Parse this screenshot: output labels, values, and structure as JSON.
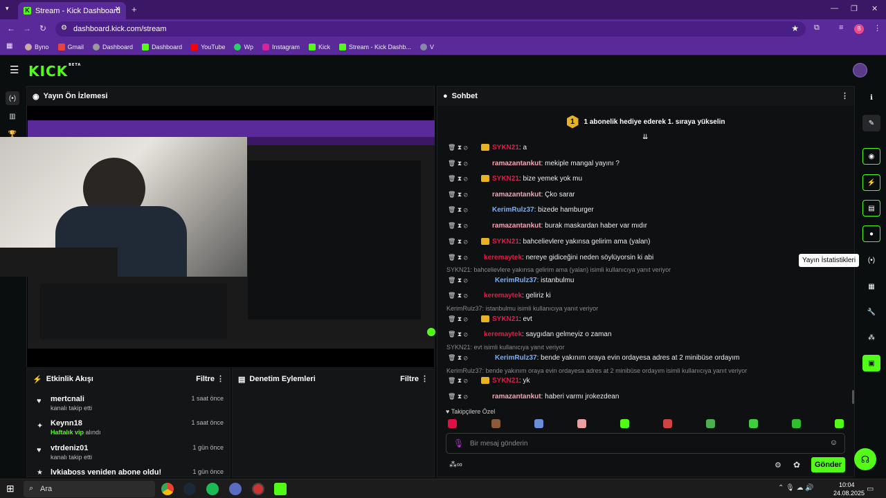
{
  "browser": {
    "tab_title": "Stream - Kick Dashboard",
    "url": "dashboard.kick.com/stream",
    "profile_initial": "B",
    "bookmarks": [
      "Byno",
      "Gmail",
      "Dashboard",
      "Dashboard",
      "YouTube",
      "Wp",
      "Instagram",
      "Kick",
      "Stream - Kick Dashb...",
      "V"
    ]
  },
  "kick": {
    "logo": "KICK",
    "logo_badge": "BETA"
  },
  "preview": {
    "title": "Yayın Ön İzlemesi"
  },
  "activity": {
    "title": "Etkinlik Akışı",
    "filter": "Filtre",
    "items": [
      {
        "name": "mertcnali",
        "sub": "kanalı takip etti",
        "time": "1 saat önce"
      },
      {
        "name": "Keynn18",
        "sub_highlight": "Haftalık vip",
        "sub": "alındı",
        "time": "1 saat önce"
      },
      {
        "name": "vtrdeniz01",
        "sub": "kanalı takip etti",
        "time": "1 gün önce"
      },
      {
        "name": "lvkiaboss veniden abone oldu!",
        "sub": "",
        "time": "1 gün önce"
      }
    ]
  },
  "moderation": {
    "title": "Denetim Eylemleri",
    "filter": "Filtre"
  },
  "chat": {
    "title": "Sohbet",
    "gift_count": "1",
    "gift_banner": "1 abonelik hediye ederek 1. sıraya yükselin",
    "messages": [
      {
        "user": "SYKN21",
        "color": "red",
        "badges": true,
        "text": ": a"
      },
      {
        "user": "ramazantankut",
        "color": "pink",
        "badges": false,
        "text": ": mekiple mangal yayını ?"
      },
      {
        "user": "SYKN21",
        "color": "red",
        "badges": true,
        "text": ": bize yemek yok mu"
      },
      {
        "user": "ramazantankut",
        "color": "pink",
        "badges": false,
        "text": ": Çko sarar"
      },
      {
        "user": "KerimRulz37",
        "color": "blue",
        "badges": false,
        "text": ": bizede hamburger"
      },
      {
        "user": "ramazantankut",
        "color": "pink",
        "badges": false,
        "text": ": burak maskardan haber var mıdır"
      },
      {
        "user": "SYKN21",
        "color": "red",
        "badges": true,
        "text": ": bahcelievlere yakınsa gelirim ama (yalan)"
      },
      {
        "user": "keremaytek",
        "color": "red",
        "badges": false,
        "text": ": nereye gidiceğini neden söylüyorsin ki abi"
      },
      {
        "reply": "SYKN21: bahcelievlere yakınsa gelirim ama (yalan) isimli kullanıcıya yanıt veriyor"
      },
      {
        "user": "KerimRulz37",
        "color": "blue",
        "badges": false,
        "text": ": istanbulmu"
      },
      {
        "user": "keremaytek",
        "color": "red",
        "badges": false,
        "text": ": geliriz ki"
      },
      {
        "reply": "KerimRulz37: istanbulmu isimli kullanıcıya yanıt veriyor"
      },
      {
        "user": "SYKN21",
        "color": "red",
        "badges": true,
        "text": ": evt"
      },
      {
        "user": "keremaytek",
        "color": "red",
        "badges": false,
        "text": ": saygıdan gelmeyiz o zaman"
      },
      {
        "reply": "SYKN21: evt isimli kullanıcıya yanıt veriyor"
      },
      {
        "user": "KerimRulz37",
        "color": "blue",
        "badges": false,
        "text": ": bende yakınım oraya evin ordayesa adres at 2 minibüse ordayım"
      },
      {
        "reply": "KerimRulz37: bende yakınım oraya evin ordayesa adres at 2 minibüse ordayım  isimli kullanıcıya yanıt veriyor"
      },
      {
        "user": "SYKN21",
        "color": "red",
        "badges": true,
        "text": ": yk"
      },
      {
        "user": "ramazantankut",
        "color": "pink",
        "badges": false,
        "text": ": haberi varmı jrokezdean"
      }
    ],
    "followers_only": "Takipçilere Özel",
    "input_placeholder": "Bir mesaj gönderin",
    "send": "Gönder"
  },
  "tooltip": "Yayın İstatistikleri",
  "taskbar": {
    "search": "Ara",
    "time": "10:04",
    "date": "24.08.2025"
  },
  "colors": {
    "accent": "#53fc18",
    "brand_purple": "#5a2a9a"
  }
}
